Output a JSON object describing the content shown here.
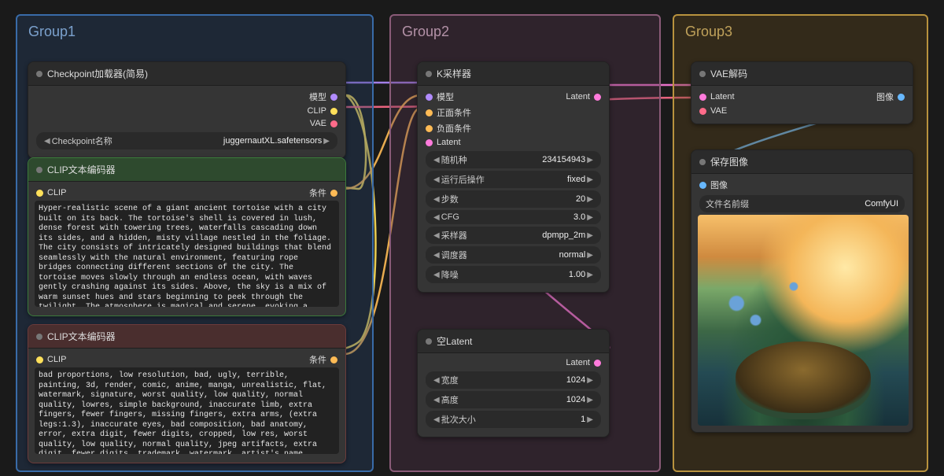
{
  "groups": {
    "g1": "Group1",
    "g2": "Group2",
    "g3": "Group3"
  },
  "checkpoint_loader": {
    "title": "Checkpoint加载器(简易)",
    "out_model": "模型",
    "out_clip": "CLIP",
    "out_vae": "VAE",
    "widget_label": "Checkpoint名称",
    "widget_value": "juggernautXL.safetensors"
  },
  "clip1": {
    "title": "CLIP文本编码器",
    "in_clip": "CLIP",
    "out_cond": "条件",
    "text": "Hyper-realistic scene of a giant ancient tortoise with a city built on its back. The tortoise's shell is covered in lush, dense forest with towering trees, waterfalls cascading down its sides, and a hidden, misty village nestled in the foliage. The city consists of intricately designed buildings that blend seamlessly with the natural environment, featuring rope bridges connecting different sections of the city. The tortoise moves slowly through an endless ocean, with waves gently crashing against its sides. Above, the sky is a mix of warm sunset hues and stars beginning to peek through the twilight. The atmosphere is magical and serene, evoking a sense of wonder and timelessness. The image captures the harmony between nature and"
  },
  "clip2": {
    "title": "CLIP文本编码器",
    "in_clip": "CLIP",
    "out_cond": "条件",
    "text": "bad proportions, low resolution, bad, ugly, terrible, painting, 3d, render, comic, anime, manga, unrealistic, flat, watermark, signature, worst quality, low quality, normal quality, lowres, simple background, inaccurate limb, extra fingers, fewer fingers, missing fingers, extra arms, (extra legs:1.3), inaccurate eyes, bad composition, bad anatomy, error, extra digit, fewer digits, cropped, low res, worst quality, low quality, normal quality, jpeg artifacts, extra digit, fewer digits, trademark, watermark, artist's name, username, signature, text, words, human,"
  },
  "ksampler": {
    "title": "K采样器",
    "in_model": "模型",
    "in_pos": "正面条件",
    "in_neg": "负面条件",
    "in_latent": "Latent",
    "out_latent": "Latent",
    "seed_label": "随机种",
    "seed_value": "234154943",
    "control_label": "运行后操作",
    "control_value": "fixed",
    "steps_label": "步数",
    "steps_value": "20",
    "cfg_label": "CFG",
    "cfg_value": "3.0",
    "sampler_label": "采样器",
    "sampler_value": "dpmpp_2m",
    "scheduler_label": "调度器",
    "scheduler_value": "normal",
    "denoise_label": "降噪",
    "denoise_value": "1.00"
  },
  "empty_latent": {
    "title": "空Latent",
    "out_latent": "Latent",
    "width_label": "宽度",
    "width_value": "1024",
    "height_label": "高度",
    "height_value": "1024",
    "batch_label": "批次大小",
    "batch_value": "1"
  },
  "vae_decode": {
    "title": "VAE解码",
    "in_latent": "Latent",
    "in_vae": "VAE",
    "out_image": "图像"
  },
  "save_image": {
    "title": "保存图像",
    "in_image": "图像",
    "prefix_label": "文件名前缀",
    "prefix_value": "ComfyUI"
  }
}
